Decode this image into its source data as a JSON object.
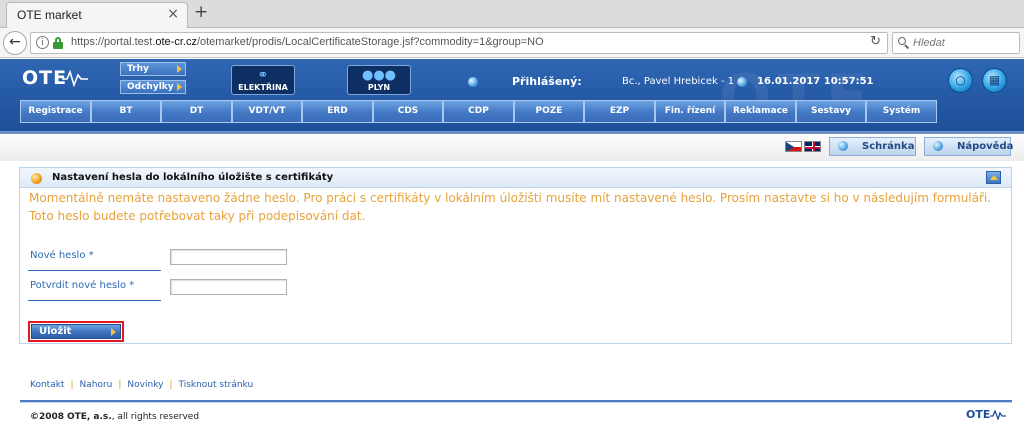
{
  "browser": {
    "tab_title": "OTE market",
    "tab_close": "×",
    "new_tab": "+",
    "url_prefix": "https://portal.test.",
    "url_domain": "ote-cr.cz",
    "url_path": "/otemarket/prodis/LocalCertificateStorage.jsf?commodity=1&group=NO",
    "search_placeholder": "Hledat"
  },
  "header": {
    "logo": "OTE",
    "buttons": [
      {
        "label": "Trhy"
      },
      {
        "label": "Odchylky"
      }
    ],
    "commodities": [
      {
        "label": "ELEKTŘINA",
        "icon": "plug-icon"
      },
      {
        "label": "PLYN",
        "icon": "gas-flame-icon"
      }
    ],
    "login_label": "Přihlášený:",
    "user_name": "Bc., Pavel Hrebicek - 1",
    "datetime": "16.01.2017 10:57:51"
  },
  "menu": {
    "items": [
      {
        "label": "Registrace"
      },
      {
        "label": "BT"
      },
      {
        "label": "DT"
      },
      {
        "label": "VDT/VT"
      },
      {
        "label": "ERD"
      },
      {
        "label": "CDS"
      },
      {
        "label": "CDP"
      },
      {
        "label": "POZE"
      },
      {
        "label": "EZP"
      },
      {
        "label": "Fin. řízení"
      },
      {
        "label": "Reklamace"
      },
      {
        "label": "Sestavy"
      },
      {
        "label": "Systém"
      }
    ]
  },
  "toolbar": {
    "inbox_label": "Schránka",
    "help_label": "Nápověda"
  },
  "panel": {
    "title": "Nastavení hesla do lokálního úložište s certifikáty",
    "message": "Momentálně nemáte nastaveno žádne heslo. Pro práci s certifikáty v lokálním úložišti musíte mít nastavené heslo. Prosím nastavte si ho v následujím formuláři. Toto heslo budete potřebovat taky při podepisování dat.",
    "fields": [
      {
        "label": "Nové heslo *",
        "value": ""
      },
      {
        "label": "Potvrdit nové heslo *",
        "value": ""
      }
    ],
    "save_label": "Uložit"
  },
  "footer": {
    "links": [
      {
        "label": "Kontakt"
      },
      {
        "label": "Nahoru"
      },
      {
        "label": "Novinky"
      },
      {
        "label": "Tisknout stránku"
      }
    ],
    "copyright_year": "©2008",
    "copyright_company": "OTE, a.s.",
    "copyright_rest": ", all rights reserved",
    "logo": "OTE"
  },
  "colors": {
    "header_blue": "#2559a6",
    "message_orange": "#e8a23a",
    "label_blue": "#2d6bb5",
    "highlight_red": "#e3171c"
  }
}
